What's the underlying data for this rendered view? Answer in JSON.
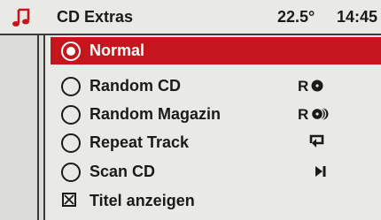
{
  "header": {
    "title": "CD Extras",
    "temperature": "22.5°",
    "time": "14:45"
  },
  "menu": [
    {
      "label": "Normal",
      "selected": true,
      "control": "radio",
      "checked": true,
      "icon": null
    },
    {
      "label": "Random CD",
      "selected": false,
      "control": "radio",
      "checked": false,
      "icon": "random-cd-icon",
      "icon_text": "R"
    },
    {
      "label": "Random Magazin",
      "selected": false,
      "control": "radio",
      "checked": false,
      "icon": "random-magazin-icon",
      "icon_text": "R"
    },
    {
      "label": "Repeat Track",
      "selected": false,
      "control": "radio",
      "checked": false,
      "icon": "repeat-track-icon"
    },
    {
      "label": "Scan CD",
      "selected": false,
      "control": "radio",
      "checked": false,
      "icon": "scan-cd-icon"
    },
    {
      "label": "Titel anzeigen",
      "selected": false,
      "control": "checkbox",
      "checked": true,
      "icon": null
    }
  ],
  "colors": {
    "accent": "#c4161c",
    "background": "#e9e9e5",
    "text": "#1a1a1a"
  }
}
